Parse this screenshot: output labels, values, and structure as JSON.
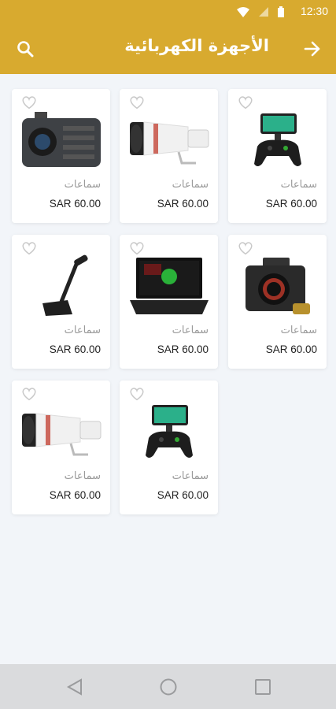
{
  "status_bar": {
    "time": "12:30",
    "icons": [
      "wifi-icon",
      "signal-icon",
      "battery-icon"
    ]
  },
  "header": {
    "title": "الأجهزة الكهربائية",
    "icons": {
      "search": "search-icon",
      "back": "arrow-right-icon"
    }
  },
  "colors": {
    "accent": "#d8aa2f",
    "background": "#f2f5f9",
    "card": "#ffffff",
    "price": "#222222",
    "name": "#9a9a9a"
  },
  "products": [
    {
      "name": "سماعات",
      "price": "SAR 60.00",
      "image": "gamepad-phone-controller"
    },
    {
      "name": "سماعات",
      "price": "SAR 60.00",
      "image": "telephoto-lens"
    },
    {
      "name": "سماعات",
      "price": "SAR 60.00",
      "image": "cinema-camera"
    },
    {
      "name": "سماعات",
      "price": "SAR 60.00",
      "image": "mirrorless-camera"
    },
    {
      "name": "سماعات",
      "price": "SAR 60.00",
      "image": "laptop"
    },
    {
      "name": "سماعات",
      "price": "SAR 60.00",
      "image": "microphone-arm"
    },
    {
      "name": "سماعات",
      "price": "SAR 60.00",
      "image": "gamepad-phone-controller"
    },
    {
      "name": "سماعات",
      "price": "SAR 60.00",
      "image": "telephoto-lens"
    }
  ],
  "nav_bar": {
    "icons": [
      "back-triangle-icon",
      "home-circle-icon",
      "recents-square-icon"
    ]
  }
}
